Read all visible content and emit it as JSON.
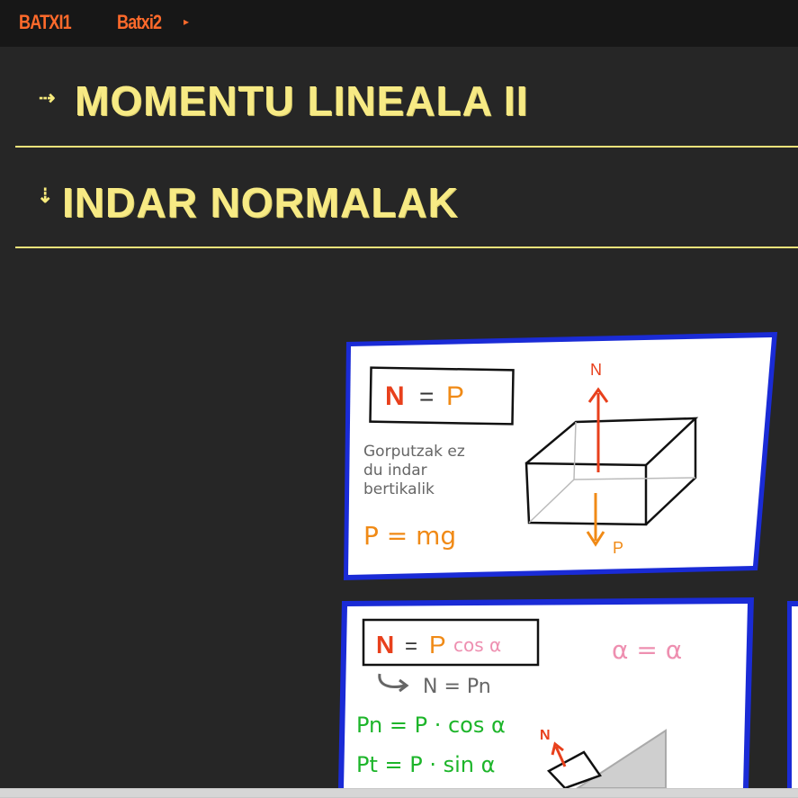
{
  "nav": {
    "item1": "BATXI1",
    "item2": "Batxi2",
    "caret": "▸"
  },
  "sections": [
    {
      "arrow": "⇢",
      "title": "MOMENTU LINEALA II"
    },
    {
      "arrow": "⇣",
      "title": "INDAR NORMALAK"
    }
  ],
  "card1": {
    "formula_N": "N",
    "formula_eq": "=",
    "formula_P": "P",
    "note_line1": "Gorputzak ez",
    "note_line2": "du indar",
    "note_line3": "bertikalik",
    "weight": "P = mg",
    "label_N": "N",
    "label_P": "P"
  },
  "card2": {
    "formula_N": "N",
    "formula_eq": "=",
    "formula_P": "P",
    "formula_cos": "cos α",
    "alpha_eq": "α = α",
    "sub": "N = Pn",
    "pn": "Pn = P · cos α",
    "pt": "Pt = P · sin α",
    "label_N": "N"
  },
  "colors": {
    "accent_yellow": "#f7ea84",
    "nav_orange": "#ff6a2b",
    "card_border": "#1a2bd6",
    "red": "#e8401c",
    "orange": "#f08a16",
    "green": "#1db52a",
    "pink": "#ee8fb0"
  }
}
